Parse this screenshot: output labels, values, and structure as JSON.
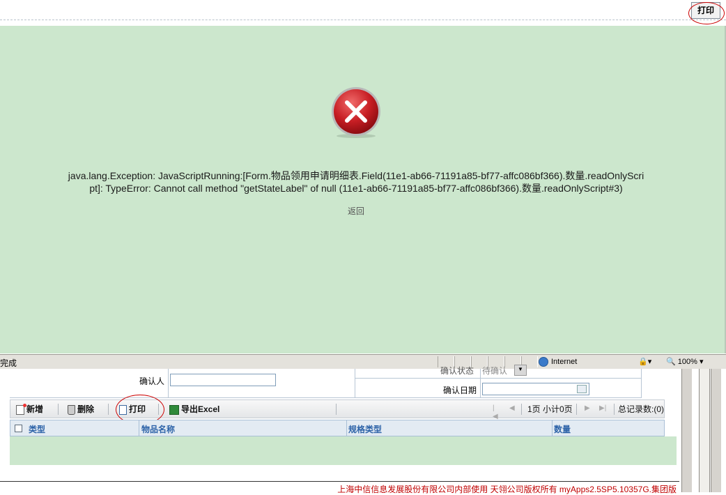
{
  "popup": {
    "print_button": "打印",
    "error_message": "java.lang.Exception: JavaScriptRunning:[Form.物品领用申请明细表.Field(11e1-ab66-71191a85-bf77-affc086bf366).数量.readOnlyScript]: TypeError: Cannot call method \"getStateLabel\" of null (11e1-ab66-71191a85-bf77-affc086bf366).数量.readOnlyScript#3)",
    "back_link": "返回"
  },
  "statusbar": {
    "status": "完成",
    "zone": "Internet",
    "zoom": "100%"
  },
  "form": {
    "confirm_person_label": "确认人",
    "confirm_person_value": "",
    "confirm_status_label": "确认状态",
    "confirm_status_value": "待确认",
    "confirm_date_label": "确认日期",
    "confirm_date_value": ""
  },
  "toolbar": {
    "add": "新增",
    "delete": "删除",
    "print": "打印",
    "export": "导出Excel"
  },
  "pager": {
    "page_info": "1页 小计0页",
    "total": "总记录数:(0)"
  },
  "grid": {
    "columns": [
      "类型",
      "物品名称",
      "规格类型",
      "数量"
    ]
  },
  "footer": {
    "text": "上海中信信息发展股份有限公司内部使用  天翎公司版权所有  myApps2.5SP5.10357G.集团版"
  },
  "colors": {
    "error_bg": "#cce7cd",
    "header_text": "#2d63a8",
    "footer_text": "#c00000",
    "annotation": "#cc0000"
  }
}
